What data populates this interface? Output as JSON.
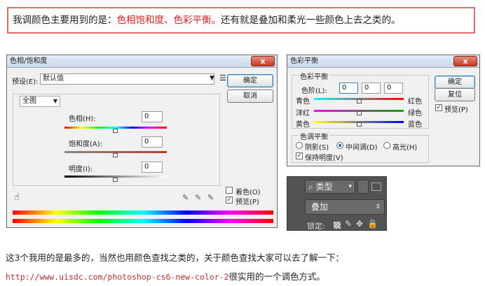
{
  "intro": {
    "part1": "我调颜色主要用到的是：",
    "part2": "色相饱和度、色彩平衡。",
    "part3": "还有就是叠加和柔光一些颜色上去之类的。"
  },
  "hue_sat": {
    "title": "色相/饱和度",
    "close": "x",
    "preset_label": "预设(E):",
    "preset_value": "默认值",
    "ok": "确定",
    "cancel": "取消",
    "channel": "全图",
    "hue_label": "色相(H):",
    "hue_value": "0",
    "sat_label": "饱和度(A):",
    "sat_value": "0",
    "light_label": "明度(I):",
    "light_value": "0",
    "colorize_label": "着色(O)",
    "preview_label": "预览(P)",
    "colorize_checked": false,
    "preview_checked": true
  },
  "color_balance": {
    "title": "色彩平衡",
    "close": "x",
    "section1": "色彩平衡",
    "levels_label": "色阶(L):",
    "levels": [
      "0",
      "0",
      "0"
    ],
    "pairs": [
      {
        "left": "青色",
        "right": "红色"
      },
      {
        "left": "洋红",
        "right": "绿色"
      },
      {
        "left": "黄色",
        "right": "蓝色"
      }
    ],
    "section2": "色调平衡",
    "tones": [
      "阴影(S)",
      "中间调(D)",
      "高光(H)"
    ],
    "selected_tone": "中间调(D)",
    "preserve_label": "保持明度(V)",
    "ok": "确定",
    "reset": "复位",
    "preview_label": "预览(P)"
  },
  "layers": {
    "filter_label": "类型",
    "blend_mode": "叠加",
    "lock_label": "锁定:"
  },
  "para1": "这3个我用的是最多的，当然也用颜色查找之类的，关于颜色查找大家可以去了解一下：",
  "url": "http://www.uisdc.com/photoshop-cs6-new-color-2",
  "para2_suffix": "很实用的一个调色方式。"
}
